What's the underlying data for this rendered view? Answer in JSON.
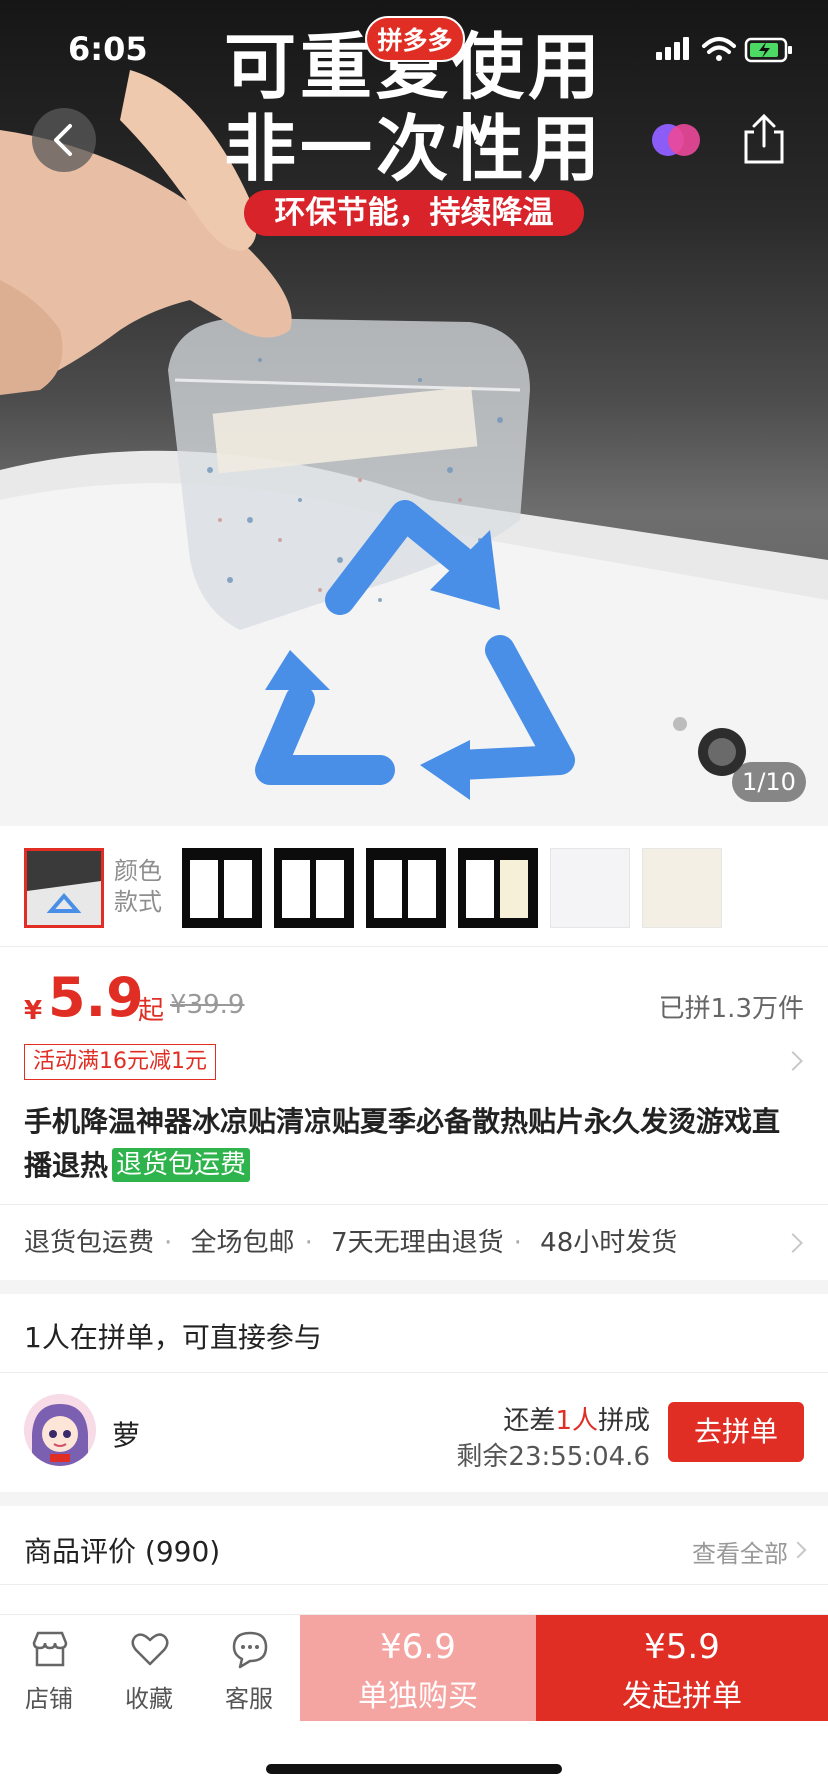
{
  "status_bar": {
    "time": "6:05"
  },
  "hero": {
    "headline_line1": "可重复使用",
    "headline_line2": "非一次性用",
    "ribbon": "环保节能，持续降温",
    "brand_logo": "拼多多",
    "counter": "1/10"
  },
  "spec": {
    "label_line1": "颜色",
    "label_line2": "款式"
  },
  "price": {
    "currency": "¥",
    "current": "5.9",
    "suffix": "起",
    "original": "¥39.9",
    "sold": "已拼1.3万件",
    "promo": "活动满16元减1元"
  },
  "product": {
    "title": "手机降温神器冰凉贴清凉贴夏季必备散热贴片永久发烫游戏直播退热",
    "tag": "退货包运费"
  },
  "services": [
    "退货包运费",
    "全场包邮",
    "7天无理由退货",
    "48小时发货"
  ],
  "group": {
    "heading": "1人在拼单，可直接参与",
    "user": "萝",
    "need_prefix": "还差",
    "need_count": "1人",
    "need_suffix": "拼成",
    "countdown": "剩余23:55:04.6",
    "join_label": "去拼单"
  },
  "reviews": {
    "heading": "商品评价 (990)",
    "view_all": "查看全部"
  },
  "bottom_bar": {
    "tabs": [
      {
        "label": "店铺",
        "icon": "store-icon"
      },
      {
        "label": "收藏",
        "icon": "heart-icon"
      },
      {
        "label": "客服",
        "icon": "chat-icon"
      }
    ],
    "buy_alone": {
      "price": "¥6.9",
      "label": "单独购买"
    },
    "buy_group": {
      "price": "¥5.9",
      "label": "发起拼单"
    }
  },
  "colors": {
    "accent": "#e02e24",
    "tag_green": "#2fb44d",
    "buy_alone_bg": "#f5a5a1"
  }
}
